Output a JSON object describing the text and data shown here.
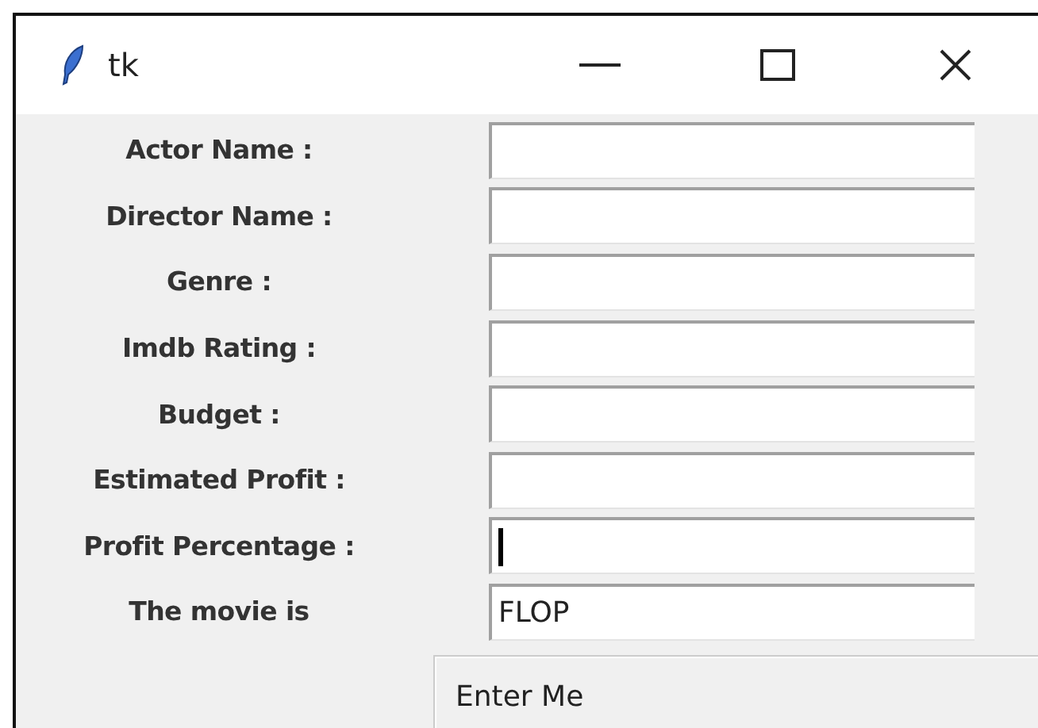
{
  "window": {
    "title": "tk"
  },
  "fields": [
    {
      "label": "Actor Name :",
      "focused": false
    },
    {
      "label": "Director Name :",
      "focused": false
    },
    {
      "label": "Genre :",
      "focused": false
    },
    {
      "label": "Imdb Rating :",
      "focused": false
    },
    {
      "label": "Budget :",
      "focused": false
    },
    {
      "label": "Estimated Profit :",
      "focused": false
    },
    {
      "label": "Profit Percentage :",
      "focused": true
    },
    {
      "label": "The movie is",
      "value": "FLOP",
      "focused": false
    }
  ],
  "button": "Enter Me"
}
